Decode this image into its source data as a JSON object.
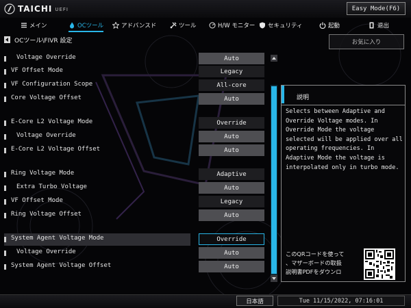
{
  "app": {
    "brand": "TAICHI",
    "brand_sub": "UEFI",
    "easy_mode_label": "Easy Mode(F6)"
  },
  "nav": [
    {
      "label": "メイン",
      "icon": "list-icon",
      "active": false
    },
    {
      "label": "OCツール",
      "icon": "flame-icon",
      "active": true
    },
    {
      "label": "アドバンスド",
      "icon": "star-icon",
      "active": false
    },
    {
      "label": "ツール",
      "icon": "tools-icon",
      "active": false
    },
    {
      "label": "H/W モニター",
      "icon": "monitor-icon",
      "active": false
    },
    {
      "label": "セキュリティ",
      "icon": "shield-icon",
      "active": false
    },
    {
      "label": "起動",
      "icon": "power-icon",
      "active": false
    },
    {
      "label": "退出",
      "icon": "exit-icon",
      "active": false
    }
  ],
  "breadcrumb": "OCツール\\FIVR 設定",
  "favorite_label": "お気に入り",
  "settings": [
    {
      "label": "Voltage Override",
      "value": "Auto",
      "indent": true,
      "selected": false
    },
    {
      "label": "VF Offset Mode",
      "value": "Legacy",
      "indent": false,
      "selected": false
    },
    {
      "label": "VF Configuration Scope",
      "value": "All-core",
      "indent": false,
      "selected": false
    },
    {
      "label": "Core Voltage Offset",
      "value": "Auto",
      "indent": false,
      "selected": false
    },
    {
      "label": "E-Core L2 Voltage Mode",
      "value": "Override",
      "indent": false,
      "selected": false
    },
    {
      "label": "Voltage Override",
      "value": "Auto",
      "indent": true,
      "selected": false
    },
    {
      "label": "E-Core L2 Voltage Offset",
      "value": "Auto",
      "indent": false,
      "selected": false
    },
    {
      "label": "Ring Voltage Mode",
      "value": "Adaptive",
      "indent": false,
      "selected": false
    },
    {
      "label": "Extra Turbo Voltage",
      "value": "Auto",
      "indent": true,
      "selected": false
    },
    {
      "label": "VF Offset Mode",
      "value": "Legacy",
      "indent": false,
      "selected": false
    },
    {
      "label": "Ring Voltage Offset",
      "value": "Auto",
      "indent": false,
      "selected": false
    },
    {
      "label": "System Agent Voltage Mode",
      "value": "Override",
      "indent": false,
      "selected": true
    },
    {
      "label": "Voltage Override",
      "value": "Auto",
      "indent": true,
      "selected": false
    },
    {
      "label": "System Agent Voltage Offset",
      "value": "Auto",
      "indent": false,
      "selected": false
    }
  ],
  "description": {
    "title": "説明",
    "body": "Selects between Adaptive and\nOverride Voltage modes. In\nOverride Mode the voltage\nselected will be applied over all\noperating frequencies. In\nAdaptive Mode the voltage is\ninterpolated only in turbo mode.",
    "qr_text": "このQRコードを使って\n、マザーボードの取扱\n説明書PDFをダウンロ"
  },
  "footer": {
    "language": "日本語",
    "datetime": "Tue 11/15/2022, 07:16:01"
  },
  "colors": {
    "accent": "#29b6e8",
    "value_box": "#4e4e52",
    "selected_row": "#2e2e33"
  }
}
